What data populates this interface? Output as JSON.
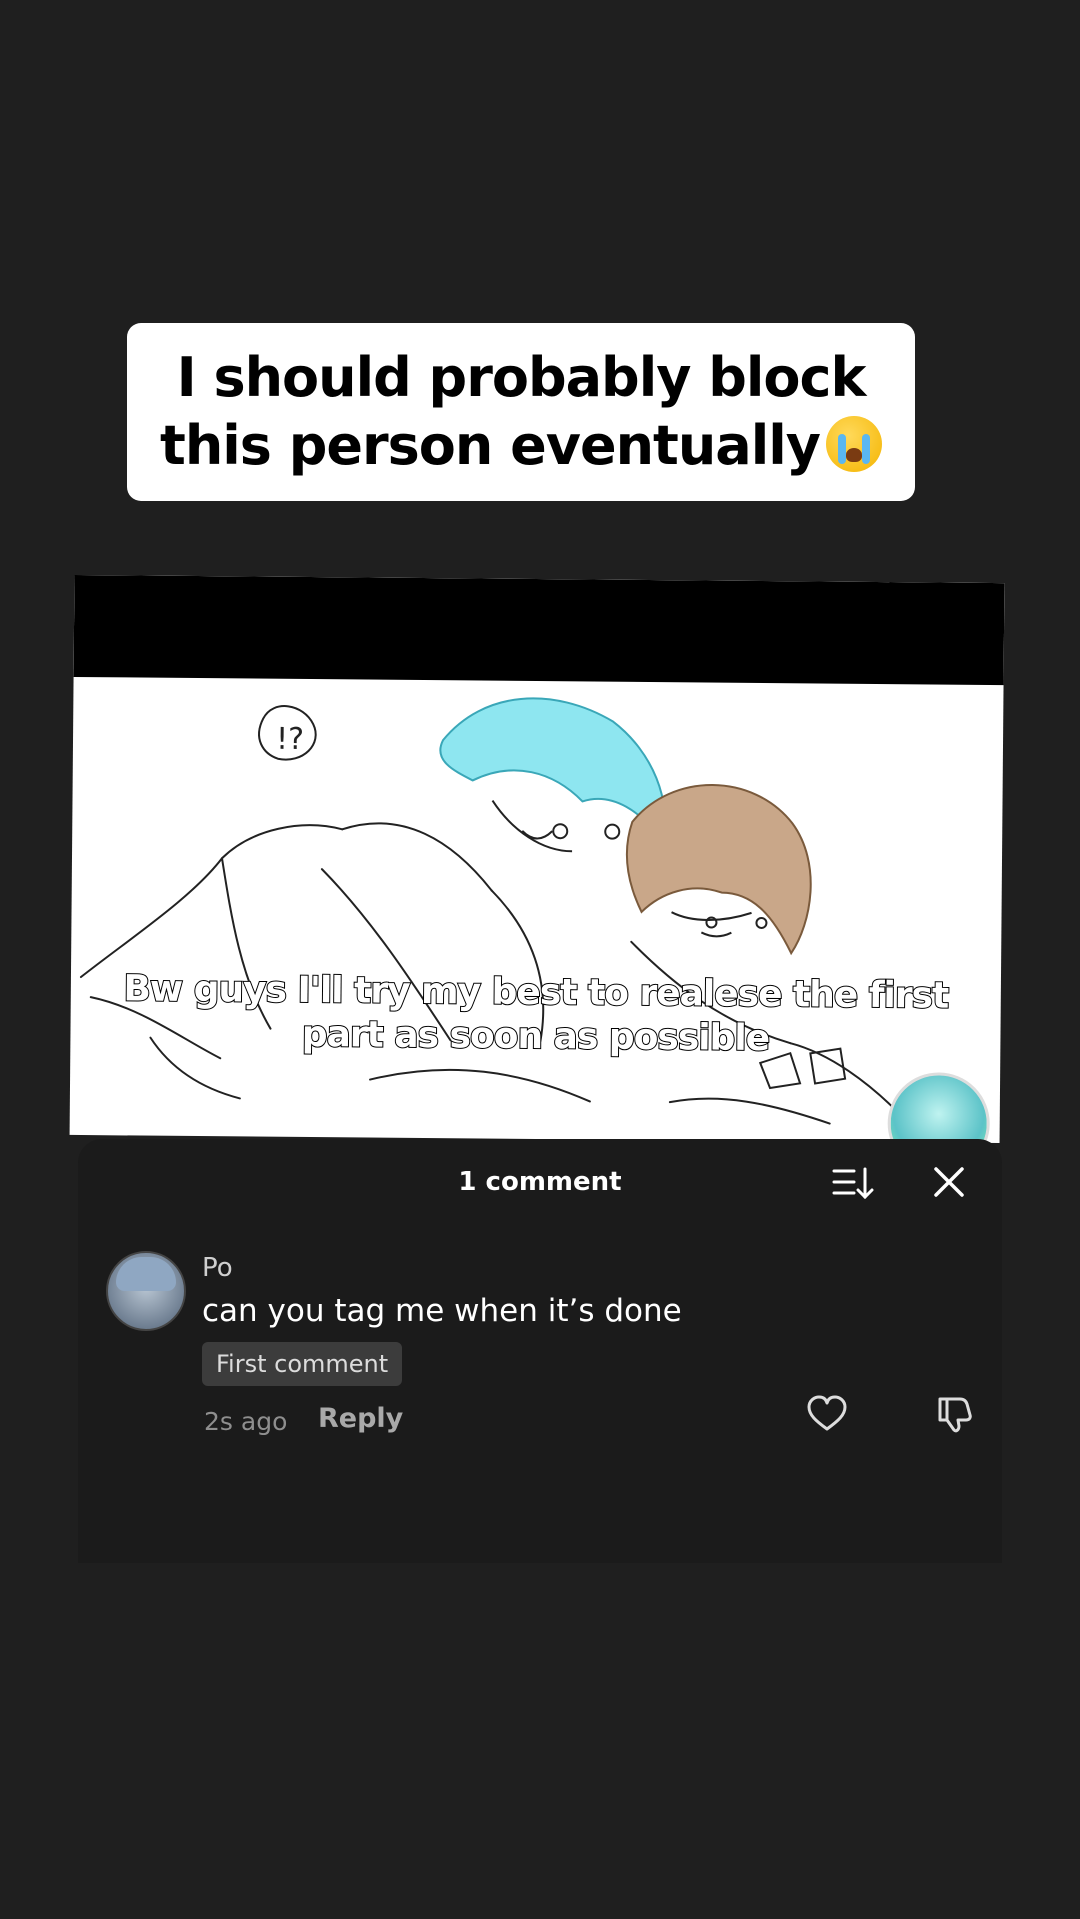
{
  "story": {
    "caption_line1": "I should probably block",
    "caption_line2": "this person eventually",
    "caption_emoji": "loudly-crying-face-emoji"
  },
  "video": {
    "subtitle_line1": "Bw guys I'll try my best to realese the first",
    "subtitle_line2": "part as soon as possible"
  },
  "comments": {
    "title": "1 comment",
    "sort_icon": "sort-icon",
    "close_icon": "close-icon",
    "items": [
      {
        "username": "Po",
        "text": "can you tag me when it’s done",
        "badge": "First comment",
        "time": "2s ago",
        "reply_label": "Reply"
      }
    ]
  },
  "colors": {
    "background": "#1f1f1f",
    "sheet": "#1b1b1b",
    "caption_bg": "#ffffff",
    "badge_bg": "#3c3c3c",
    "hair_blue": "#8ee6f0",
    "hair_brown": "#c9a789"
  }
}
